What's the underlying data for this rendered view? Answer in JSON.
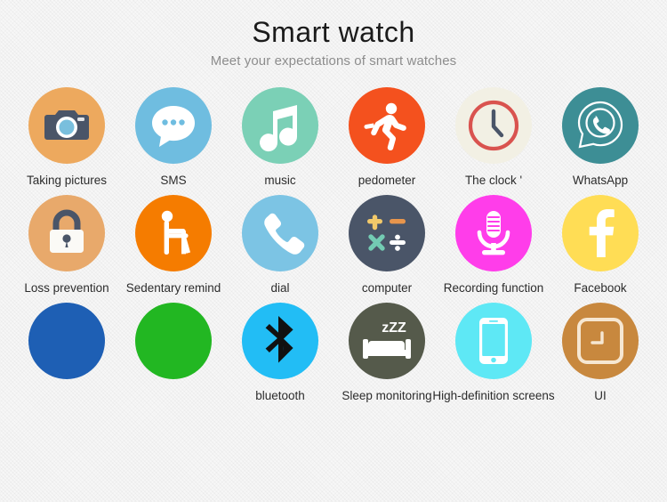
{
  "header": {
    "title": "Smart watch",
    "subtitle": "Meet your expectations of smart watches"
  },
  "colors": {
    "background": "#f7f7f7",
    "title_text": "#1b1b1b",
    "subtitle_text": "#8d8d8d",
    "label_text": "#2c2c2c"
  },
  "grid": {
    "columns": 6,
    "rows": 3,
    "items": [
      {
        "id": "taking-pictures",
        "label": "Taking pictures",
        "icon": "camera-icon",
        "circle_color": "#eda95e",
        "icon_color": "#4a5568"
      },
      {
        "id": "sms",
        "label": "SMS",
        "icon": "speech-bubble-icon",
        "circle_color": "#6fbde0",
        "icon_color": "#ffffff"
      },
      {
        "id": "music",
        "label": "music",
        "icon": "music-note-icon",
        "circle_color": "#7bd0b6",
        "icon_color": "#ffffff"
      },
      {
        "id": "pedometer",
        "label": "pedometer",
        "icon": "running-person-icon",
        "circle_color": "#f4511e",
        "icon_color": "#ffffff"
      },
      {
        "id": "the-clock",
        "label": "The clock '",
        "icon": "clock-icon",
        "circle_color": "#f2f0e4",
        "icon_color": "#d9534f"
      },
      {
        "id": "whatsapp",
        "label": "WhatsApp",
        "icon": "whatsapp-icon",
        "circle_color": "#3d8e95",
        "icon_color": "#ffffff"
      },
      {
        "id": "loss-prevention",
        "label": "Loss prevention",
        "icon": "padlock-icon",
        "circle_color": "#e8a96b",
        "icon_color": "#4a5568"
      },
      {
        "id": "sedentary-remind",
        "label": "Sedentary remind",
        "icon": "sitting-person-icon",
        "circle_color": "#f57c00",
        "icon_color": "#ffffff"
      },
      {
        "id": "dial",
        "label": "dial",
        "icon": "phone-handset-icon",
        "circle_color": "#7cc4e4",
        "icon_color": "#ffffff"
      },
      {
        "id": "computer",
        "label": "computer",
        "icon": "calculator-icon",
        "circle_color": "#4a5568",
        "icon_color": "#ffffff"
      },
      {
        "id": "recording",
        "label": "Recording function",
        "icon": "microphone-icon",
        "circle_color": "#ff3dea",
        "icon_color": "#ffffff"
      },
      {
        "id": "facebook",
        "label": "Facebook",
        "icon": "facebook-icon",
        "circle_color": "#ffdd55",
        "icon_color": "#ffffff"
      },
      {
        "id": "blank-blue",
        "label": "",
        "icon": "none",
        "circle_color": "#1e5fb4",
        "icon_color": "#1e5fb4"
      },
      {
        "id": "blank-green",
        "label": "",
        "icon": "none",
        "circle_color": "#22b722",
        "icon_color": "#22b722"
      },
      {
        "id": "bluetooth",
        "label": "bluetooth",
        "icon": "bluetooth-icon",
        "circle_color": "#22bdf5",
        "icon_color": "#111111"
      },
      {
        "id": "sleep-monitoring",
        "label": "Sleep monitoring",
        "icon": "bed-sleep-icon",
        "circle_color": "#555a4b",
        "icon_color": "#ffffff"
      },
      {
        "id": "hd-screens",
        "label": "High-definition screens",
        "icon": "smartphone-icon",
        "circle_color": "#5ee8f5",
        "icon_color": "#ffffff"
      },
      {
        "id": "ui",
        "label": "UI",
        "icon": "ui-clock-square-icon",
        "circle_color": "#c8883e",
        "icon_color": "#f6e7d2"
      }
    ]
  }
}
